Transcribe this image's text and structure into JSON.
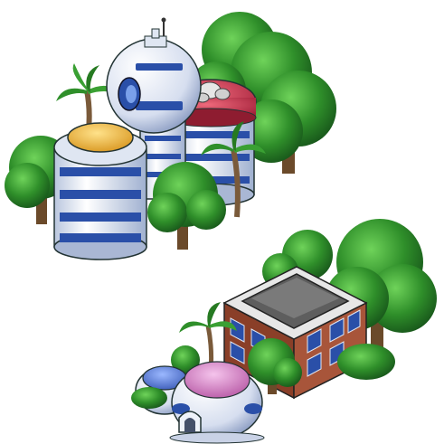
{
  "scene": {
    "background": "#ffffff",
    "sprites": [
      {
        "name": "capsule-corp-dome-complex",
        "kind": "building-set"
      },
      {
        "name": "brick-office-and-igloo-homes",
        "kind": "building-set"
      }
    ],
    "colors": {
      "tree_dark": "#1f6b1c",
      "tree_mid": "#2f8f2a",
      "tree_light": "#5cc24a",
      "trunk": "#6b4a2a",
      "dome_white": "#e8eef8",
      "dome_shade": "#b9c6de",
      "window_blue": "#2a4fa8",
      "roof_yellow": "#f2b63a",
      "roof_red": "#c8354a",
      "brick": "#9a4a32",
      "roof_gray": "#6d6d6d",
      "igloo_pink": "#d98ac8",
      "igloo_blue": "#5a7fd8"
    }
  }
}
